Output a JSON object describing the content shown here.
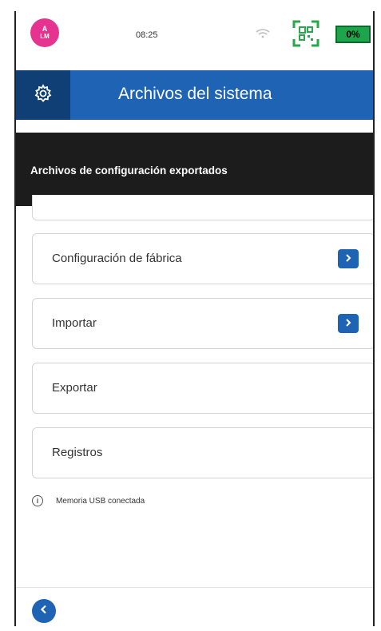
{
  "status_bar": {
    "avatar_initial_top": "A",
    "avatar_initials": "LM",
    "time": "08:25",
    "battery": "0%",
    "wifi_icon": "wifi-off-icon",
    "qr_icon": "qr-code-icon"
  },
  "header": {
    "title": "Archivos del sistema",
    "icon": "gear-icon"
  },
  "banner": {
    "text": "Archivos de configuración exportados"
  },
  "menu": {
    "items": [
      {
        "label": "Configuración de fábrica",
        "has_chevron": true
      },
      {
        "label": "Importar",
        "has_chevron": true
      },
      {
        "label": "Exportar",
        "has_chevron": false
      },
      {
        "label": "Registros",
        "has_chevron": false
      }
    ]
  },
  "info": {
    "text": "Memoria USB conectada"
  },
  "colors": {
    "accent_blue": "#1f64b4",
    "header_dark": "#0f3f75",
    "banner_black": "#1c1c1c",
    "battery_green": "#1ea54b",
    "avatar_pink": "#e6338f"
  }
}
